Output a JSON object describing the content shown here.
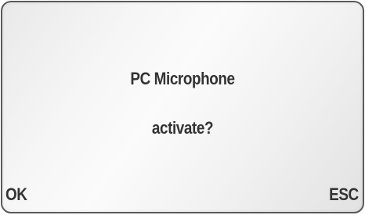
{
  "dialog": {
    "line1": "PC Microphone",
    "line2": "activate?"
  },
  "softkeys": {
    "left": "OK",
    "right": "ESC"
  }
}
